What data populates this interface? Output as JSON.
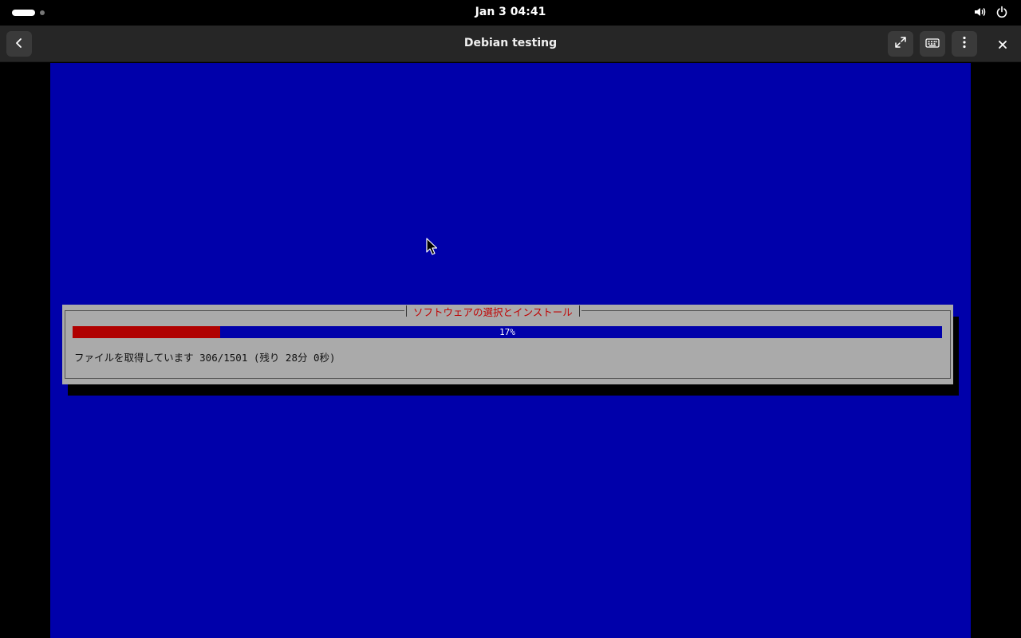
{
  "system_bar": {
    "clock": "Jan 3  04:41",
    "icons": [
      "activities-indicator",
      "volume-icon",
      "power-icon"
    ]
  },
  "headerbar": {
    "title": "Debian testing",
    "buttons": [
      "back-icon",
      "fullscreen-icon",
      "keyboard-icon",
      "menu-icon",
      "close-icon"
    ]
  },
  "installer": {
    "dialog_title": "ソフトウェアの選択とインストール",
    "progress_percent": 17,
    "progress_label": "17%",
    "status": "ファイルを取得しています 306/1501 (残り 28分 0秒)"
  },
  "colors": {
    "screen_bg": "#0000aa",
    "dialog_bg": "#aaaaaa",
    "progress_fill": "#b00000",
    "title_text": "#c00000"
  }
}
